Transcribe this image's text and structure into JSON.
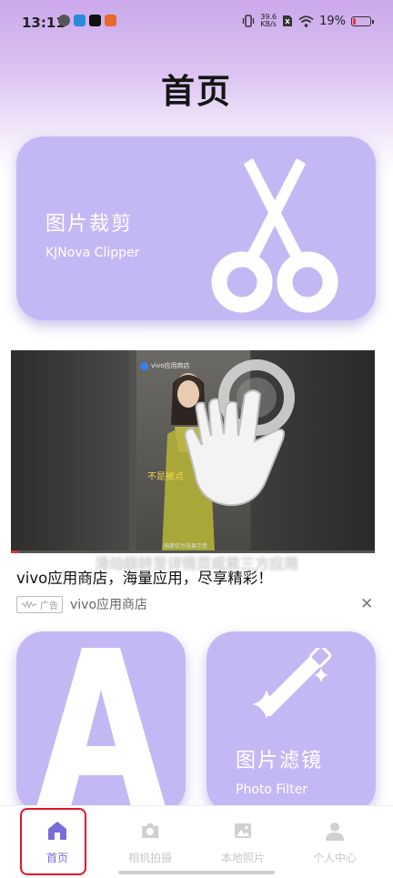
{
  "status_bar": {
    "time": "13:11",
    "speed_value": "39.6",
    "speed_unit": "KB/s",
    "battery": "19%",
    "battery_level": 0.19
  },
  "page": {
    "title": "首页"
  },
  "cards": {
    "clipper": {
      "title": "图片裁剪",
      "subtitle": "KJNova Clipper",
      "icon": "scissors-icon"
    },
    "text": {
      "icon": "letter-a-icon"
    },
    "filter": {
      "title": "图片滤镜",
      "subtitle": "Photo Filter",
      "icon": "magic-wand-icon"
    }
  },
  "ad": {
    "video_store_label": "vivo应用商店",
    "video_caption": "不是被点",
    "video_subtitle": "画面仅为效果示意",
    "overlay_text": "滑动跳转至详情页或第三方应用",
    "headline": "vivo应用商店，海量应用，尽享精彩！",
    "badge": "广告",
    "advertiser": "vivo应用商店",
    "close_icon": "close-icon"
  },
  "nav": {
    "items": [
      {
        "label": "首页",
        "icon": "home-icon",
        "active": true
      },
      {
        "label": "相机拍摄",
        "icon": "camera-icon",
        "active": false
      },
      {
        "label": "本地照片",
        "icon": "gallery-icon",
        "active": false
      },
      {
        "label": "个人中心",
        "icon": "person-icon",
        "active": false
      }
    ]
  },
  "colors": {
    "card": "#c4b8f4",
    "accent": "#7a6bd8",
    "highlight": "#e0132a"
  }
}
